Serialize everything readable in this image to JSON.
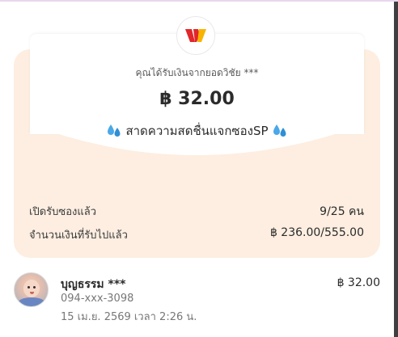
{
  "envelope": {
    "received_text": "คุณได้รับเงินจากยอดวิชัย ***",
    "amount": "฿ 32.00",
    "message": "สาดความสดชื่นแจกซองSP",
    "opened_label": "เปิดรับซองแล้ว",
    "opened_value": "9/25 คน",
    "received_total_label": "จำนวนเงินที่รับไปแล้ว",
    "received_total_value": "฿ 236.00/555.00"
  },
  "recipient": {
    "name": "บุญธรรม ***",
    "phone": "094-xxx-3098",
    "datetime": "15 เม.ย. 2569 เวลา 2:26 น.",
    "amount": "฿ 32.00"
  },
  "colors": {
    "envelope_bg": "#fdeee1",
    "logo_red": "#e2262a",
    "logo_yellow": "#f7b500"
  }
}
